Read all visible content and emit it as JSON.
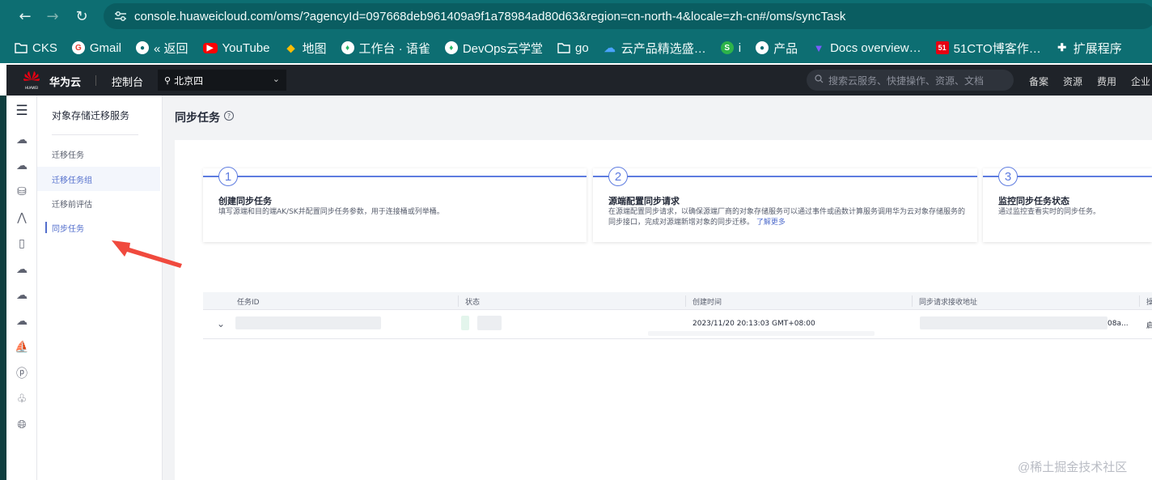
{
  "browser": {
    "url": "console.huaweicloud.com/oms/?agencyId=097668deb961409a9f1a78984ad80d63&region=cn-north-4&locale=zh-cn#/oms/syncTask",
    "bookmarks": [
      {
        "label": "CKS",
        "icon": "folder-icon"
      },
      {
        "label": "Gmail",
        "icon": "google-icon"
      },
      {
        "label": "« 返回",
        "icon": "globe-icon"
      },
      {
        "label": "YouTube",
        "icon": "youtube-icon"
      },
      {
        "label": "地图",
        "icon": "maps-icon"
      },
      {
        "label": "工作台 · 语雀",
        "icon": "yuque-icon"
      },
      {
        "label": "DevOps云学堂",
        "icon": "yuque-icon"
      },
      {
        "label": "go",
        "icon": "folder-icon"
      },
      {
        "label": "云产品精选盛…",
        "icon": "cloud-icon"
      },
      {
        "label": "i",
        "icon": "s-icon"
      },
      {
        "label": "产品",
        "icon": "globe-icon"
      },
      {
        "label": "Docs overview…",
        "icon": "docs-icon"
      },
      {
        "label": "51CTO博客作…",
        "icon": "51cto-icon"
      },
      {
        "label": "扩展程序",
        "icon": "puzzle-icon"
      }
    ]
  },
  "topbar": {
    "brand": "华为云",
    "logo_text": "HUAWEI",
    "console": "控制台",
    "region": "北京四",
    "search_placeholder": "搜索云服务、快捷操作、资源、文档",
    "nav": [
      "备案",
      "资源",
      "费用",
      "企业"
    ]
  },
  "submenu": {
    "title": "对象存储迁移服务",
    "items": [
      "迁移任务",
      "迁移任务组",
      "迁移前评估",
      "同步任务"
    ]
  },
  "page": {
    "title": "同步任务",
    "help": "?"
  },
  "steps": [
    {
      "num": "1",
      "title": "创建同步任务",
      "desc": "填写源端和目的端AK/SK并配置同步任务参数，用于连接桶或列举桶。"
    },
    {
      "num": "2",
      "title": "源端配置同步请求",
      "desc": "在源端配置同步请求，以确保源端厂商的对象存储服务可以通过事件或函数计算服务调用华为云对象存储服务的同步接口，完成对源端新增对象的同步迁移。",
      "link": "了解更多"
    },
    {
      "num": "3",
      "title": "监控同步任务状态",
      "desc": "通过监控查看实时的同步任务。"
    }
  ],
  "table": {
    "headers": [
      "任务ID",
      "状态",
      "创建时间",
      "同步请求接收地址",
      "操"
    ],
    "rows": [
      {
        "created": "2023/11/20 20:13:03 GMT+08:00",
        "address_tail": "08a...",
        "op_tail": "启"
      }
    ]
  },
  "watermark": "@稀土掘金技术社区",
  "colors": {
    "accent": "#5e7ce0",
    "topbar": "#1f2329",
    "browser": "#0d6e72",
    "arrow": "#f04a3e"
  }
}
